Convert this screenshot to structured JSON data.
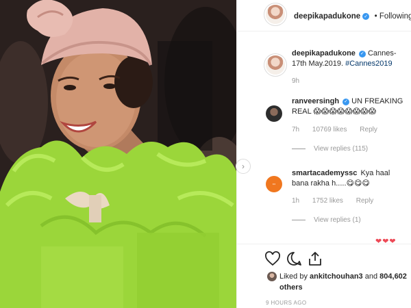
{
  "post": {
    "username": "deepikapadukone",
    "following_label": "• Following",
    "caption_text": "Cannes-17th May.2019.",
    "caption_hashtag": "#Cannes2019",
    "caption_age": "9h"
  },
  "comments": [
    {
      "username": "ranveersingh",
      "verified": true,
      "text": "UN FREAKING REAL 😱😱😱😱😱😱😱😱",
      "age": "7h",
      "likes": "10769 likes",
      "reply_label": "Reply",
      "view_replies": "View replies (115)"
    },
    {
      "username": "smartacademyssc",
      "verified": false,
      "text": "Kya haal bana rakha h.....😋😋😋",
      "age": "1h",
      "likes": "1752 likes",
      "reply_label": "Reply",
      "view_replies": "View replies (1)"
    }
  ],
  "partial_row": "❤❤❤",
  "engagement": {
    "liked_by_prefix": "Liked by",
    "liked_by_user": "ankitchouhan3",
    "and_label": "and",
    "others": "804,602 others",
    "time_ago": "9 HOURS AGO"
  },
  "icons": {
    "like": "heart-icon",
    "comment": "comment-icon",
    "share": "share-icon",
    "next": "chevron-right-icon",
    "verified": "verified-badge-icon"
  },
  "colors": {
    "verified_blue": "#3897f0",
    "hashtag": "#003569",
    "muted": "#999999",
    "dress_green": "#9bd63a",
    "turban_pink": "#e6b7ae"
  }
}
